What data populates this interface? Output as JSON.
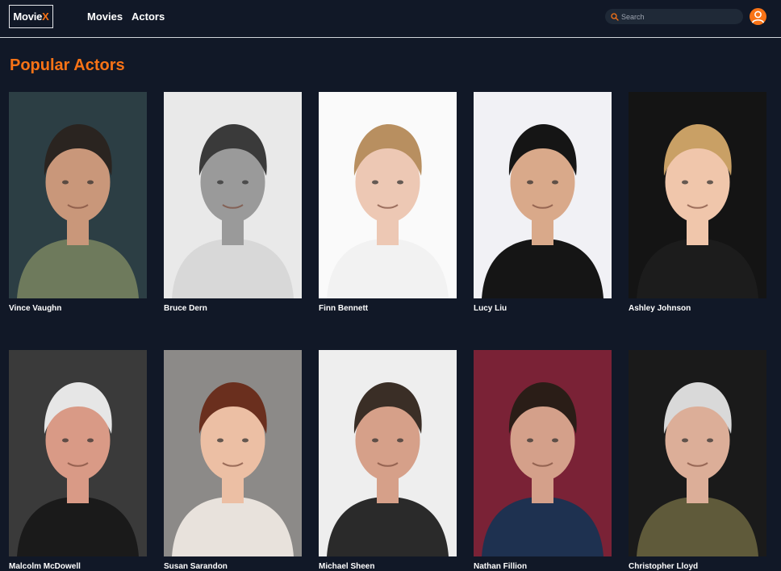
{
  "app": {
    "logo_text": "Movie",
    "logo_accent": "X",
    "accent_color": "#f97316",
    "background_color": "#111827"
  },
  "nav": {
    "items": [
      {
        "label": "Movies"
      },
      {
        "label": "Actors"
      }
    ]
  },
  "search": {
    "placeholder": "Search",
    "value": "",
    "icon": "search-icon"
  },
  "user": {
    "icon": "user-avatar-icon"
  },
  "page": {
    "title": "Popular Actors"
  },
  "actors": [
    {
      "name": "Vince Vaughn",
      "bg": "#2c3e44",
      "skin": "#c9977a",
      "hair": "#2a2420",
      "shirt": "#6e7a5c"
    },
    {
      "name": "Bruce Dern",
      "bg": "#e9e9e9",
      "skin": "#9a9a9a",
      "hair": "#3a3a3a",
      "shirt": "#d8d8d8"
    },
    {
      "name": "Finn Bennett",
      "bg": "#fafafa",
      "skin": "#edc8b4",
      "hair": "#b88f60",
      "shirt": "#f2f2f2"
    },
    {
      "name": "Lucy Liu",
      "bg": "#f1f1f5",
      "skin": "#d9a98a",
      "hair": "#151515",
      "shirt": "#151515"
    },
    {
      "name": "Ashley Johnson",
      "bg": "#141414",
      "skin": "#f0c6ab",
      "hair": "#c9a065",
      "shirt": "#1c1c1c"
    },
    {
      "name": "Malcolm McDowell",
      "bg": "#3a3a3a",
      "skin": "#d99a86",
      "hair": "#e6e6e6",
      "shirt": "#1a1a1a"
    },
    {
      "name": "Susan Sarandon",
      "bg": "#8c8a88",
      "skin": "#ecbfa4",
      "hair": "#6a2f1e",
      "shirt": "#e8e2dc"
    },
    {
      "name": "Michael Sheen",
      "bg": "#eeeeee",
      "skin": "#d6a089",
      "hair": "#3a2e26",
      "shirt": "#2a2a2a"
    },
    {
      "name": "Nathan Fillion",
      "bg": "#7a2236",
      "skin": "#d4a08a",
      "hair": "#2a1d17",
      "shirt": "#1e3150"
    },
    {
      "name": "Christopher Lloyd",
      "bg": "#1a1a1a",
      "skin": "#dcae98",
      "hair": "#d9d9d9",
      "shirt": "#5f5a3a"
    }
  ]
}
